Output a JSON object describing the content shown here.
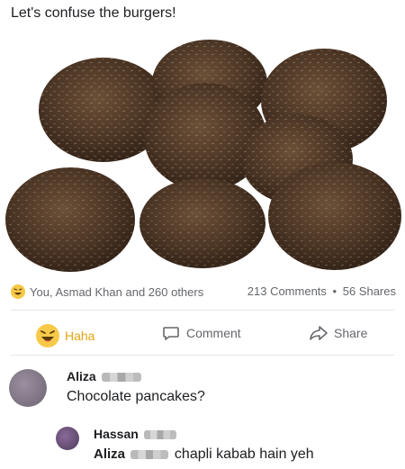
{
  "post": {
    "text": "Let's confuse the burgers!"
  },
  "reactions": {
    "summary": "You, Asmad Khan and 260 others",
    "comments": "213 Comments",
    "separator": "•",
    "shares": "56 Shares"
  },
  "actions": {
    "haha": "Haha",
    "comment": "Comment",
    "share": "Share"
  },
  "comments": [
    {
      "author": "Aliza",
      "text": "Chocolate pancakes?"
    },
    {
      "author": "Hassan",
      "mention": "Aliza",
      "text": "chapli kabab hain yeh"
    }
  ],
  "colors": {
    "haha_accent": "#e3a512",
    "muted_text": "#65676b",
    "patty": "#4a3424"
  }
}
